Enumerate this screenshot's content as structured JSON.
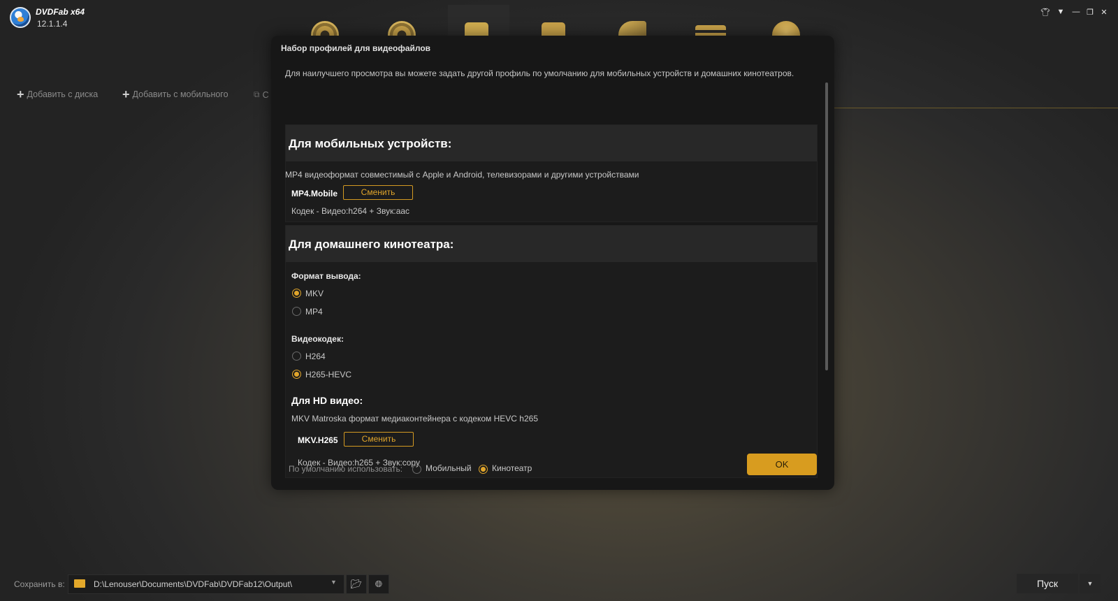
{
  "app": {
    "name": "DVDFab x64",
    "version": "12.1.1.4"
  },
  "window_controls": [
    "skin-icon",
    "menu-icon",
    "minimize-icon",
    "restore-icon",
    "close-icon"
  ],
  "toolbar": {
    "add_disc": "Добавить с диска",
    "add_mobile": "Добавить с мобильного",
    "third_partial": "С"
  },
  "dialog": {
    "title": "Набор профилей для видеофайлов",
    "description": "Для наилучшего просмотра вы можете задать другой профиль по умолчанию для мобильных устройств и домашних кинотеатров.",
    "mobile": {
      "heading": "Для мобильных устройств:",
      "desc": "MP4 видеоформат совместимый с Apple и Android, телевизорами и другими устройствами",
      "profile": "MP4.Mobile",
      "change": "Сменить",
      "codec": "Кодек - Видео:h264 + Звук:aac"
    },
    "home": {
      "heading": "Для домашнего кинотеатра:",
      "format_label": "Формат вывода:",
      "formats": [
        {
          "label": "MKV",
          "selected": true
        },
        {
          "label": "MP4",
          "selected": false
        }
      ],
      "codec_label": "Видеокодек:",
      "codecs": [
        {
          "label": "H264",
          "selected": false
        },
        {
          "label": "H265-HEVC",
          "selected": true
        }
      ],
      "hd_title": "Для HD видео:",
      "hd_desc": "MKV Matroska формат медиаконтейнера с кодеком HEVC h265",
      "profile": "MKV.H265",
      "change": "Сменить",
      "codec": "Кодек - Видео:h265 + Звук:copy"
    },
    "default_use_label": "По умолчанию использовать:",
    "default_options": [
      {
        "label": "Мобильный",
        "selected": false
      },
      {
        "label": "Кинотеатр",
        "selected": true
      }
    ],
    "ok": "OK"
  },
  "bottom": {
    "save_label": "Сохранить в:",
    "path": "D:\\Lenouser\\Documents\\DVDFab\\DVDFab12\\Output\\",
    "start": "Пуск"
  },
  "colors": {
    "accent": "#e0a52b",
    "ok_button": "#d89c1f"
  }
}
